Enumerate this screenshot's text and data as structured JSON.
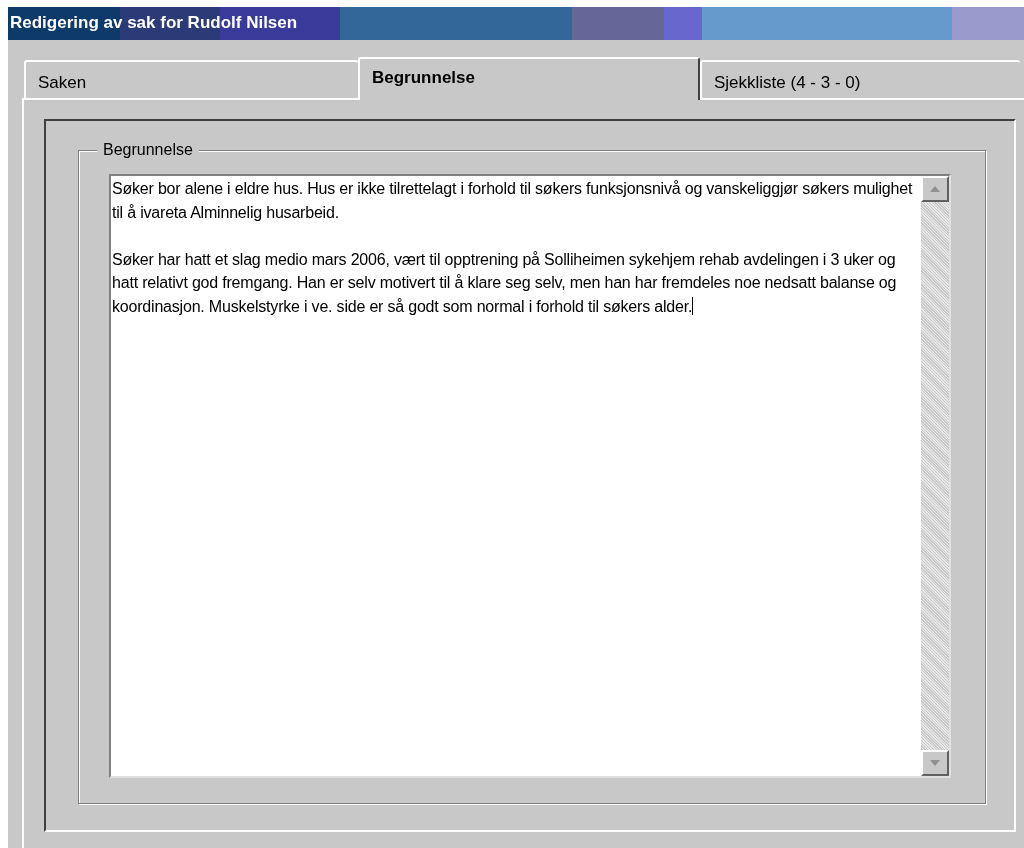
{
  "window": {
    "title": "Redigering av sak for Rudolf Nilsen"
  },
  "tabs": [
    {
      "label": "Saken",
      "selected": false
    },
    {
      "label": "Begrunnelse",
      "selected": true
    },
    {
      "label": "Sjekkliste (4 - 3 - 0)",
      "selected": false
    }
  ],
  "group": {
    "title": "Begrunnelse",
    "paragraphs": [
      "Søker bor alene i eldre hus. Hus er ikke tilrettelagt i forhold til søkers funksjonsnivå og vanskeliggjør søkers mulighet til å ivareta Alminnelig husarbeid.",
      "Søker har hatt et slag medio mars 2006, vært til opptrening på Solliheimen sykehjem rehab avdelingen i 3 uker og hatt relativt god fremgang. Han er selv motivert til å klare seg selv, men han har fremdeles noe nedsatt balanse og koordinasjon. Muskelstyrke i ve. side er så godt som normal i forhold til søkers alder."
    ]
  }
}
